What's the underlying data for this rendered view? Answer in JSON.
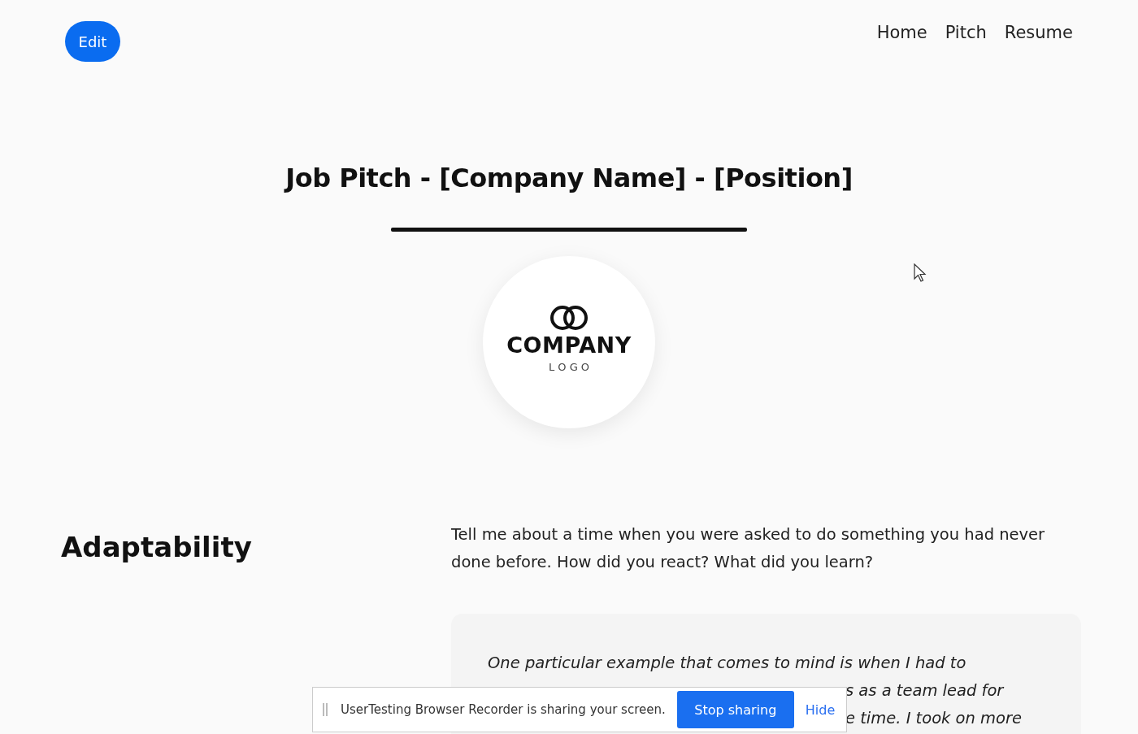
{
  "header": {
    "edit_button": "Edit",
    "nav": [
      {
        "label": "Home"
      },
      {
        "label": "Pitch"
      },
      {
        "label": "Resume"
      }
    ]
  },
  "title": "Job Pitch - [Company Name] - [Position]",
  "logo": {
    "name": "COMPANY",
    "tagline": "L O G O"
  },
  "section": {
    "heading": "Adaptability",
    "question": "Tell me about a time when you were asked to do something you had never done before. How did you react? What did you learn?",
    "answer_line": "One particular example that comes to mind is when I had to",
    "answer_fragments": [
      "s as a team lead for",
      "e time. I took on more"
    ]
  },
  "share_bar": {
    "message": "UserTesting Browser Recorder is sharing your screen.",
    "stop_button": "Stop sharing",
    "hide_link": "Hide"
  }
}
